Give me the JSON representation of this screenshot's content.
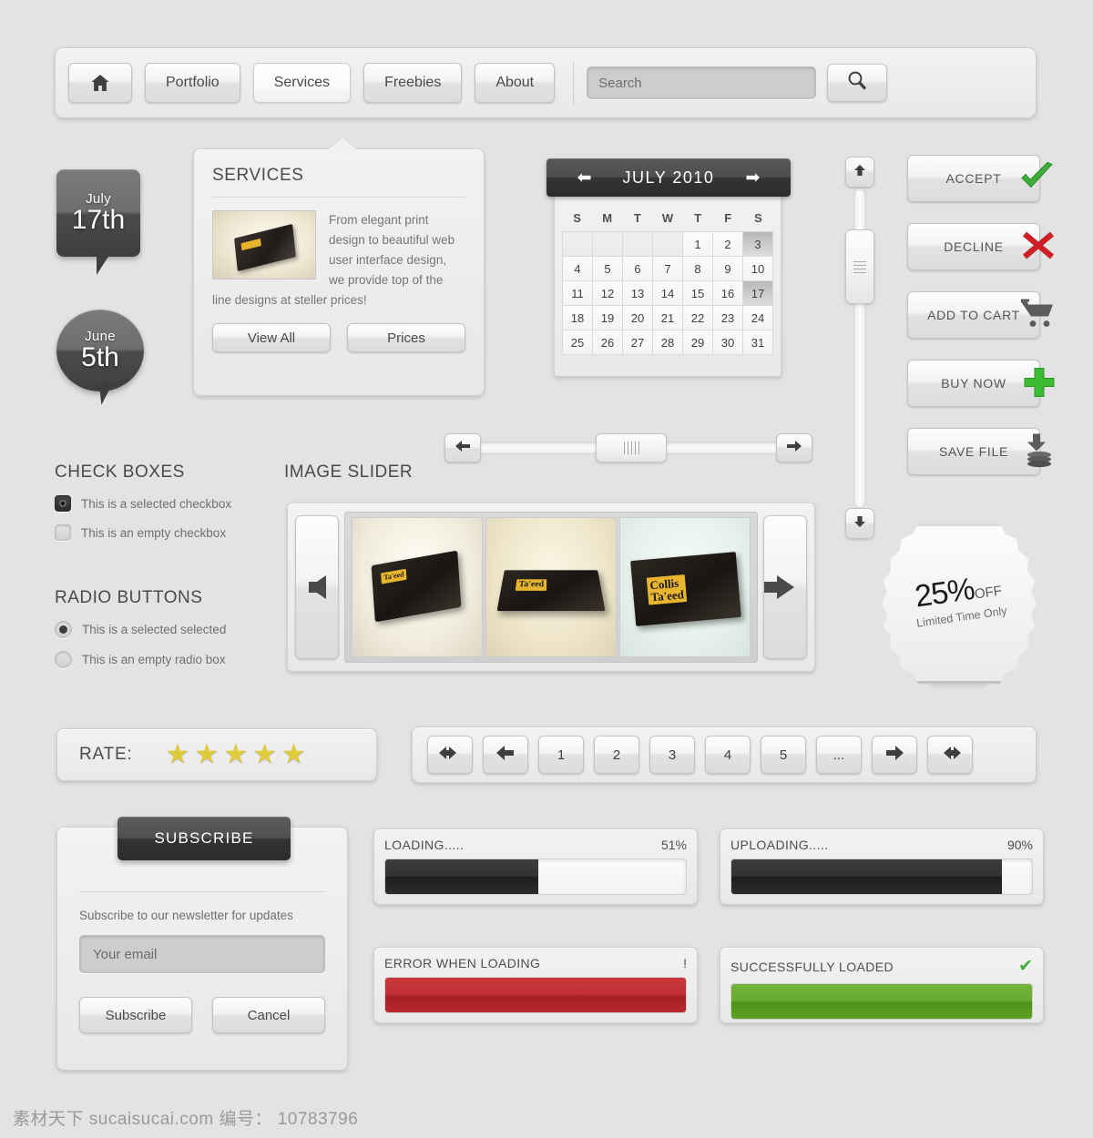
{
  "nav": {
    "home_icon": "home-icon",
    "items": [
      {
        "label": "Portfolio",
        "active": false
      },
      {
        "label": "Services",
        "active": true
      },
      {
        "label": "Freebies",
        "active": false
      },
      {
        "label": "About",
        "active": false
      }
    ],
    "search": {
      "placeholder": "Search",
      "value": "",
      "button_icon": "search-icon"
    }
  },
  "date_bubbles": [
    {
      "month": "July",
      "day": "17th",
      "shape": "rounded-rect"
    },
    {
      "month": "June",
      "day": "5th",
      "shape": "ellipse"
    }
  ],
  "services": {
    "title": "SERVICES",
    "body": "From elegant print design to beautiful web user interface design, we provide top of the line designs at steller prices!",
    "thumb_icon": "business-card-stack-image",
    "buttons": [
      {
        "label": "View All"
      },
      {
        "label": "Prices"
      }
    ]
  },
  "calendar": {
    "title": "JULY 2010",
    "prev_icon": "arrow-left-icon",
    "next_icon": "arrow-right-icon",
    "day_headers": [
      "S",
      "M",
      "T",
      "W",
      "T",
      "F",
      "S"
    ],
    "leading_blanks": 4,
    "days": [
      1,
      2,
      3,
      4,
      5,
      6,
      7,
      8,
      9,
      10,
      11,
      12,
      13,
      14,
      15,
      16,
      17,
      18,
      19,
      20,
      21,
      22,
      23,
      24,
      25,
      26,
      27,
      28,
      29,
      30,
      31
    ],
    "highlighted": [
      3,
      17
    ],
    "today": 17
  },
  "vertical_scrollbar": {
    "up_icon": "arrow-up-icon",
    "down_icon": "arrow-down-icon",
    "thumb_grip": "grip-lines-icon",
    "thumb_position_pct": 18
  },
  "action_buttons": [
    {
      "label": "ACCEPT",
      "icon": "green-check-icon",
      "color": "#3eae3a"
    },
    {
      "label": "DECLINE",
      "icon": "red-cross-icon",
      "color": "#cc2026"
    },
    {
      "label": "ADD TO CART",
      "icon": "shopping-cart-icon",
      "color": "#5c5c5c"
    },
    {
      "label": "BUY NOW",
      "icon": "green-plus-icon",
      "color": "#3cbb34"
    },
    {
      "label": "SAVE FILE",
      "icon": "save-disk-download-icon",
      "color": "#5c5c5c"
    }
  ],
  "checkboxes": {
    "title": "CHECK BOXES",
    "items": [
      {
        "label": "This is a selected checkbox",
        "checked": true
      },
      {
        "label": "This is an empty checkbox",
        "checked": false
      }
    ]
  },
  "radios": {
    "title": "RADIO BUTTONS",
    "items": [
      {
        "label": "This is a selected selected",
        "checked": true
      },
      {
        "label": "This is an empty radio box",
        "checked": false
      }
    ]
  },
  "horizontal_slider": {
    "left_icon": "arrow-left-icon",
    "right_icon": "arrow-right-icon",
    "thumb_grip": "grip-bars-icon",
    "thumb_position_pct": 50
  },
  "image_slider": {
    "title": "IMAGE SLIDER",
    "prev_icon": "arrow-left-icon",
    "next_icon": "arrow-right-icon",
    "slides": [
      {
        "name": "fanned-business-cards-image",
        "brand": "Collis Ta'eed"
      },
      {
        "name": "stacked-business-card-box-image",
        "brand": "Collis Ta'eed"
      },
      {
        "name": "tilted-business-card-image",
        "brand": "Collis Ta'eed"
      }
    ]
  },
  "badge": {
    "percent": "25%",
    "off": "OFF",
    "subtitle": "Limited Time Only"
  },
  "rate": {
    "label": "RATE:",
    "stars_total": 5,
    "stars_filled": 5,
    "star_icon": "star-icon"
  },
  "pagination": {
    "items": [
      {
        "label": "",
        "icon": "double-arrow-left-icon"
      },
      {
        "label": "",
        "icon": "arrow-left-icon"
      },
      {
        "label": "1",
        "icon": ""
      },
      {
        "label": "2",
        "icon": ""
      },
      {
        "label": "3",
        "icon": ""
      },
      {
        "label": "4",
        "icon": ""
      },
      {
        "label": "5",
        "icon": ""
      },
      {
        "label": "...",
        "icon": ""
      },
      {
        "label": "",
        "icon": "arrow-right-icon"
      },
      {
        "label": "",
        "icon": "double-arrow-right-icon"
      }
    ]
  },
  "subscribe": {
    "tab_label": "SUBSCRIBE",
    "copy": "Subscribe to our newsletter for updates",
    "email_placeholder": "Your email",
    "email_value": "",
    "submit_label": "Subscribe",
    "cancel_label": "Cancel"
  },
  "progress": [
    {
      "key": "loading",
      "label": "LOADING.....",
      "value": "51%",
      "percent": 51,
      "fill": "dark",
      "icon": ""
    },
    {
      "key": "uploading",
      "label": "UPLOADING.....",
      "value": "90%",
      "percent": 90,
      "fill": "dark",
      "icon": ""
    },
    {
      "key": "error",
      "label": "ERROR WHEN LOADING",
      "value": "!",
      "percent": 100,
      "fill": "red",
      "icon": "exclamation-icon"
    },
    {
      "key": "success",
      "label": "SUCCESSFULLY LOADED",
      "value": "✔",
      "percent": 100,
      "fill": "green",
      "icon": "green-check-icon"
    }
  ],
  "watermark": "素材天下 sucaisucai.com  编号： 10783796",
  "colors": {
    "page_bg": "#e3e3e3",
    "panel_bg": "#f0f0f0",
    "accent_dark": "#333333",
    "green": "#3eae3a",
    "red": "#bf2f33",
    "star_yellow": "#e0cb3d",
    "text": "#4a4a4a"
  }
}
